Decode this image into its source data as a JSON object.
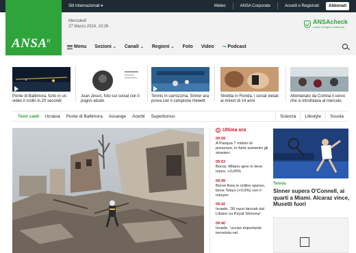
{
  "topbar": {
    "intl_label": "Siti Internazionali",
    "links": [
      "Meteo",
      "ANSA Corporate",
      "Accedi o Registrati"
    ],
    "subscribe_label": "Abbonati"
  },
  "header": {
    "logo": "ANSA",
    "logo_suffix": "it",
    "date_line1": "Mercoledì",
    "date_line2": "27 Marzo 2024, 10:26",
    "anscheck_name": "ANSAcheck",
    "anscheck_tag": "notizie d'origine certificata",
    "brand_color": "#2ea43a"
  },
  "nav": {
    "menu_label": "Menu",
    "items": [
      "Sezioni",
      "Canali",
      "Regioni"
    ],
    "plain_items": [
      "Foto",
      "Video"
    ],
    "podcast_label": "Podcast"
  },
  "strip": [
    {
      "caption": "Ponte di Baltimora, furto in un video il crollo in 20 secondi"
    },
    {
      "caption": "Juan Jesus, foto sui social con il pugno alzato"
    },
    {
      "caption": "Tennis in carrozzina, Sinner ara prova con il campione Hewett"
    },
    {
      "caption": "Strettta in Florida, i social vietati ai minori di 14 anni"
    },
    {
      "caption": "Allontanato da Cortina il cervo che si intrufolava al mercato"
    }
  ],
  "hot": {
    "label": "Temi caldi",
    "tags": [
      "Ucraina",
      "Ponte di Baltimora",
      "Assange",
      "Acerbi",
      "Superbonus"
    ],
    "right": [
      "Scienza",
      "Lifestyle",
      "Scuola"
    ]
  },
  "ultima": {
    "title": "Ultima ora",
    "items": [
      {
        "time": "09:59",
        "text": "A Pasqua 7 milioni di presenze, in forte aumento gli stranieri"
      },
      {
        "time": "09:53",
        "text": "Borsa: Milano apre in lieve rialzo, +0,05%"
      },
      {
        "time": "09:49",
        "text": "Borse Asia in ordine sparso, bene Tokyo (+0,9%) con il minyen"
      },
      {
        "time": "09:42",
        "text": "Israele, '30 razzi lanciati dal Libano su Kiryat Shmona'"
      },
      {
        "time": "09:40",
        "text": "Israele, 'ucciso importante terrorista nel"
      }
    ]
  },
  "sport": {
    "category": "Tennis",
    "title": "Sinner supera O'Connell, ai quarti a Miami. Alcaraz vince, Musetti fuori"
  }
}
